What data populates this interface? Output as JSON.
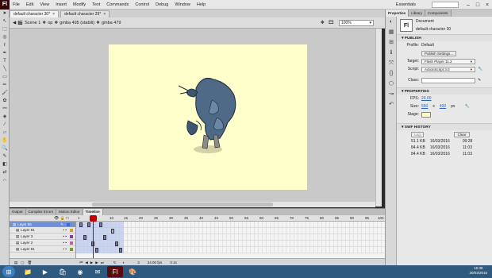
{
  "app": {
    "logo": "Fl"
  },
  "menu": [
    "File",
    "Edit",
    "View",
    "Insert",
    "Modify",
    "Text",
    "Commands",
    "Control",
    "Debug",
    "Window",
    "Help"
  ],
  "workspace": "Essentials",
  "doc_tabs": [
    {
      "label": "default character 30*"
    },
    {
      "label": "default character 29*"
    }
  ],
  "breadcrumb": [
    "Scene 1",
    "op",
    "gmba 495 (stabili)",
    "gmba 479"
  ],
  "zoom": "100%",
  "panel_tabs": [
    "Output",
    "Compiler Errors",
    "Motion Editor",
    "Timeline"
  ],
  "timeline": {
    "ruler": [
      "1",
      "5",
      "10",
      "15",
      "20",
      "25",
      "30",
      "35",
      "40",
      "45",
      "50",
      "55",
      "60",
      "65",
      "70",
      "75",
      "80",
      "85",
      "90",
      "95",
      "100"
    ],
    "layers": [
      {
        "name": "Layer 55",
        "color": "#3a6bd8"
      },
      {
        "name": "Layer 81",
        "color": "#d8a12a"
      },
      {
        "name": "Layer 3",
        "color": "#8a36a8"
      },
      {
        "name": "Layer 2",
        "color": "#c45a9c"
      },
      {
        "name": "Layer 81",
        "color": "#7a9a2a"
      }
    ],
    "footer": {
      "frame": "3",
      "fps": "24.00 fps",
      "time": "0.1s"
    }
  },
  "properties": {
    "tabs": [
      "Properties",
      "Library",
      "Components"
    ],
    "doc_type": "Document",
    "doc_name": "default character 30",
    "publish": {
      "title": "PUBLISH",
      "profile_label": "Profile:",
      "profile_value": "Default",
      "settings_btn": "Publish Settings...",
      "target_label": "Target:",
      "target_value": "Flash Player 11.2",
      "script_label": "Script:",
      "script_value": "ActionScript 3.0",
      "class_label": "Class:"
    },
    "props": {
      "title": "PROPERTIES",
      "fps_label": "FPS:",
      "fps_value": "24.00",
      "size_label": "Size:",
      "width": "550",
      "x": "x",
      "height": "400",
      "unit": "px",
      "stage_label": "Stage:",
      "stage_color": "#ffffcc"
    },
    "history": {
      "title": "SWF HISTORY",
      "log_btn": "Log",
      "clear_btn": "Clear",
      "rows": [
        {
          "size": "51.1 KB",
          "date": "16/03/2016",
          "time": "09:28"
        },
        {
          "size": "84.4 KB",
          "date": "16/03/2016",
          "time": "11:03"
        },
        {
          "size": "84.4 KB",
          "date": "16/03/2016",
          "time": "11:03"
        }
      ]
    }
  },
  "taskbar": {
    "time": "15:39",
    "date": "30/03/2016"
  },
  "colors": {
    "accent": "#6c8fd9",
    "stage": "#ffffcc",
    "menubar": "#e8e8e8",
    "taskbar": "#2e5a80"
  }
}
